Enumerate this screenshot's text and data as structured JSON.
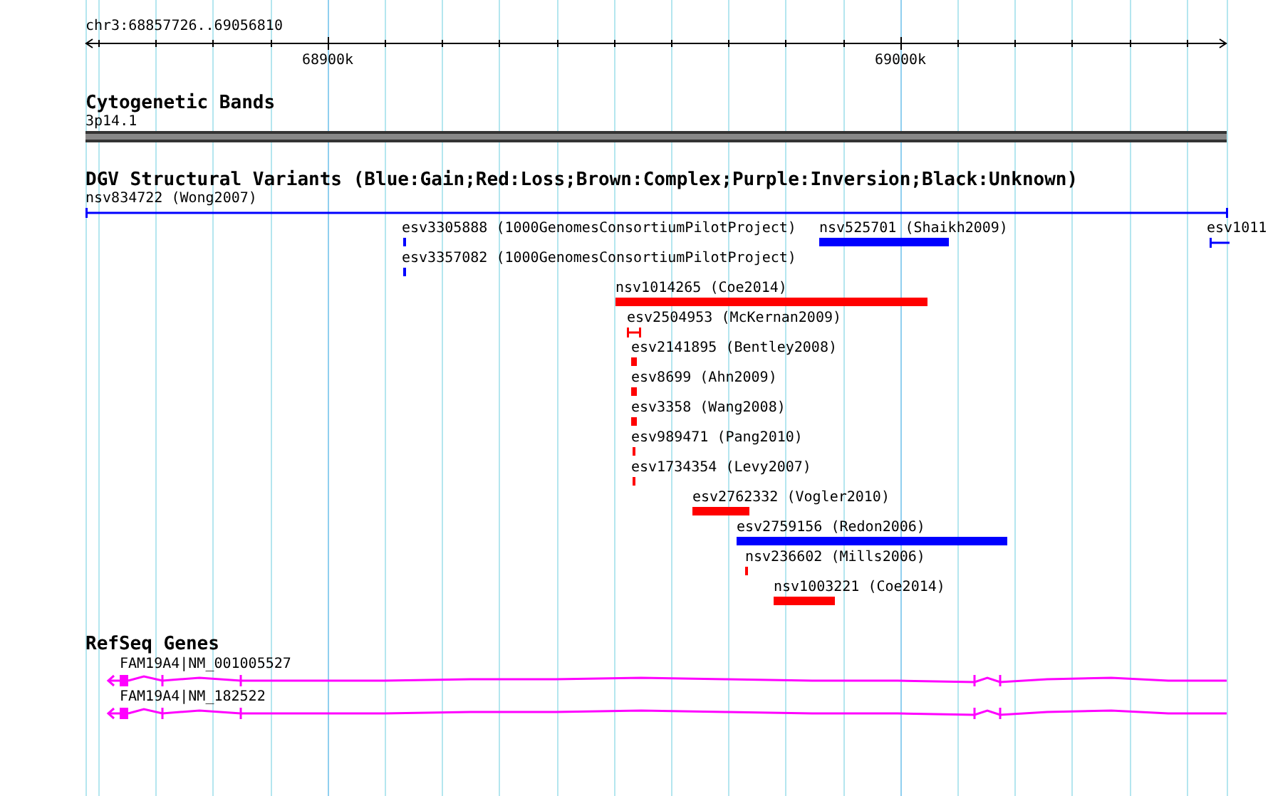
{
  "ruler": {
    "region": "chr3:68857726..69056810",
    "ticks": [
      "68900k",
      "69000k"
    ]
  },
  "tracks": [
    {
      "kind": "bands",
      "title": "Cytogenetic Bands",
      "features": [
        {
          "label": "3p14.1"
        }
      ]
    },
    {
      "kind": "variants",
      "title": "DGV Structural Variants (Blue:Gain;Red:Loss;Brown:Complex;Purple:Inversion;Black:Unknown)",
      "features": [
        {
          "label": "nsv834722 (Wong2007)",
          "color": "#0000ff"
        },
        {
          "label": "esv3305888 (1000GenomesConsortiumPilotProject)",
          "color": "#0000ff"
        },
        {
          "label": "nsv525701 (Shaikh2009)",
          "color": "#0000ff"
        },
        {
          "label": "esv1011",
          "color": "#0000ff"
        },
        {
          "label": "esv3357082 (1000GenomesConsortiumPilotProject)",
          "color": "#0000ff"
        },
        {
          "label": "nsv1014265 (Coe2014)",
          "color": "#ff0000"
        },
        {
          "label": "esv2504953 (McKernan2009)",
          "color": "#ff0000"
        },
        {
          "label": "esv2141895 (Bentley2008)",
          "color": "#ff0000"
        },
        {
          "label": "esv8699 (Ahn2009)",
          "color": "#ff0000"
        },
        {
          "label": "esv3358 (Wang2008)",
          "color": "#ff0000"
        },
        {
          "label": "esv989471 (Pang2010)",
          "color": "#ff0000"
        },
        {
          "label": "esv1734354 (Levy2007)",
          "color": "#ff0000"
        },
        {
          "label": "esv2762332 (Vogler2010)",
          "color": "#ff0000"
        },
        {
          "label": "esv2759156 (Redon2006)",
          "color": "#0000ff"
        },
        {
          "label": "nsv236602 (Mills2006)",
          "color": "#ff0000"
        },
        {
          "label": "nsv1003221 (Coe2014)",
          "color": "#ff0000"
        }
      ]
    },
    {
      "kind": "genes",
      "title": "RefSeq Genes",
      "features": [
        {
          "label": "FAM19A4|NM_001005527"
        },
        {
          "label": "FAM19A4|NM_182522"
        }
      ]
    }
  ]
}
